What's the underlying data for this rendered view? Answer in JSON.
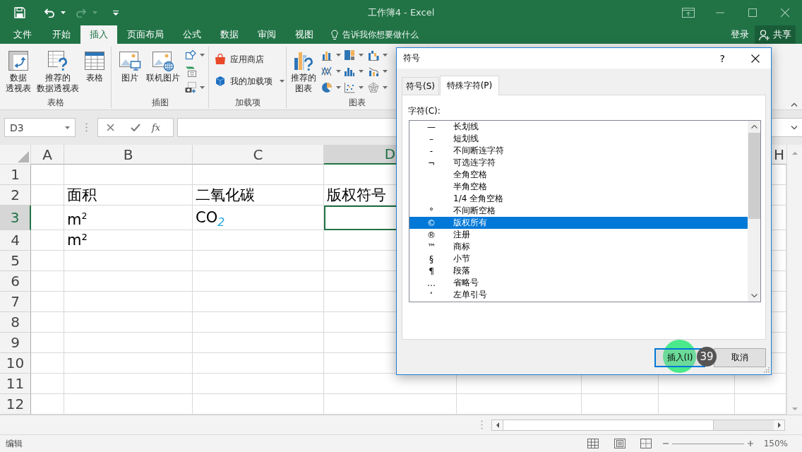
{
  "title_bar": {
    "title": "工作簿4 - Excel"
  },
  "ribbon_tabs": [
    {
      "label": "文件",
      "selected": false
    },
    {
      "label": "开始",
      "selected": false
    },
    {
      "label": "插入",
      "selected": true
    },
    {
      "label": "页面布局",
      "selected": false
    },
    {
      "label": "公式",
      "selected": false
    },
    {
      "label": "数据",
      "selected": false
    },
    {
      "label": "审阅",
      "selected": false
    },
    {
      "label": "视图",
      "selected": false
    }
  ],
  "tell_me": {
    "placeholder": "告诉我你想要做什么"
  },
  "account": {
    "sign_in": "登录",
    "share": "共享"
  },
  "ribbon": {
    "groups": [
      {
        "label": "表格",
        "items": [
          {
            "kind": "large",
            "lines": [
              "数据",
              "透视表"
            ]
          },
          {
            "kind": "large",
            "lines": [
              "推荐的",
              "数据透视表"
            ]
          },
          {
            "kind": "large",
            "lines": [
              "表格"
            ]
          }
        ]
      },
      {
        "label": "插图",
        "items": [
          {
            "kind": "large",
            "lines": [
              "图片"
            ]
          },
          {
            "kind": "large",
            "lines": [
              "联机图片"
            ]
          },
          {
            "kind": "icon_stack"
          }
        ]
      },
      {
        "label": "加载项",
        "items": [
          {
            "kind": "row",
            "label": "应用商店",
            "dropdown": false
          },
          {
            "kind": "row",
            "label": "我的加载项",
            "dropdown": true
          }
        ]
      },
      {
        "label": "图表",
        "items": [
          {
            "kind": "large",
            "lines": [
              "推荐的",
              "图表"
            ]
          },
          {
            "kind": "icon_grid"
          }
        ]
      }
    ]
  },
  "formula_bar": {
    "name_box": "D3",
    "insert_function": "fx"
  },
  "sheet": {
    "columns": [
      {
        "label": "A",
        "selected": false
      },
      {
        "label": "B",
        "selected": false
      },
      {
        "label": "C",
        "selected": false
      },
      {
        "label": "D",
        "selected": true
      },
      null,
      null,
      null,
      {
        "label": "H",
        "selected": false
      }
    ],
    "rows": [
      {
        "label": "1",
        "selected": false
      },
      {
        "label": "2",
        "selected": false,
        "cells": [
          null,
          "面积",
          "二氧化碳",
          "版权符号"
        ]
      },
      {
        "label": "3",
        "selected": true,
        "cells": [
          null,
          "m$^{2}$",
          "CO$_{2}$"
        ]
      },
      {
        "label": "4",
        "selected": false,
        "cells": [
          null,
          "m²"
        ]
      },
      {
        "label": "5",
        "selected": false
      },
      {
        "label": "6",
        "selected": false
      },
      {
        "label": "7",
        "selected": false
      },
      {
        "label": "8",
        "selected": false
      },
      {
        "label": "9",
        "selected": false
      },
      {
        "label": "10",
        "selected": false
      },
      {
        "label": "11",
        "selected": false
      },
      {
        "label": "12",
        "selected": false
      }
    ]
  },
  "status_bar": {
    "mode": "编辑",
    "zoom": "150%"
  },
  "dialog": {
    "title": "符号",
    "help": "?",
    "tabs": [
      {
        "label": "符号(S)",
        "selected": false
      },
      {
        "label": "特殊字符(P)",
        "selected": true
      }
    ],
    "list_label": "字符(C):",
    "characters": [
      {
        "symbol": "—",
        "name": "长划线",
        "selected": false
      },
      {
        "symbol": "–",
        "name": "短划线",
        "selected": false
      },
      {
        "symbol": "‑",
        "name": "不间断连字符",
        "selected": false
      },
      {
        "symbol": "¬",
        "name": "可选连字符",
        "selected": false
      },
      {
        "name": "全角空格",
        "selected": false
      },
      {
        "name": "半角空格",
        "selected": false
      },
      {
        "name": "1/4 全角空格",
        "selected": false
      },
      {
        "symbol": "°",
        "name": "不间断空格",
        "selected": false
      },
      {
        "symbol": "©",
        "name": "版权所有",
        "selected": true
      },
      {
        "symbol": "®",
        "name": "注册",
        "selected": false
      },
      {
        "symbol": "™",
        "name": "商标",
        "selected": false
      },
      {
        "symbol": "§",
        "name": "小节",
        "selected": false
      },
      {
        "symbol": "¶",
        "name": "段落",
        "selected": false
      },
      {
        "symbol": "…",
        "name": "省略号",
        "selected": false
      },
      {
        "symbol": "‘",
        "name": "左单引号",
        "selected": false
      }
    ],
    "buttons": [
      {
        "label": "插入(I)",
        "default": true
      },
      {
        "label": "取消",
        "default": false
      }
    ]
  },
  "click_marker": {
    "step": "39"
  }
}
